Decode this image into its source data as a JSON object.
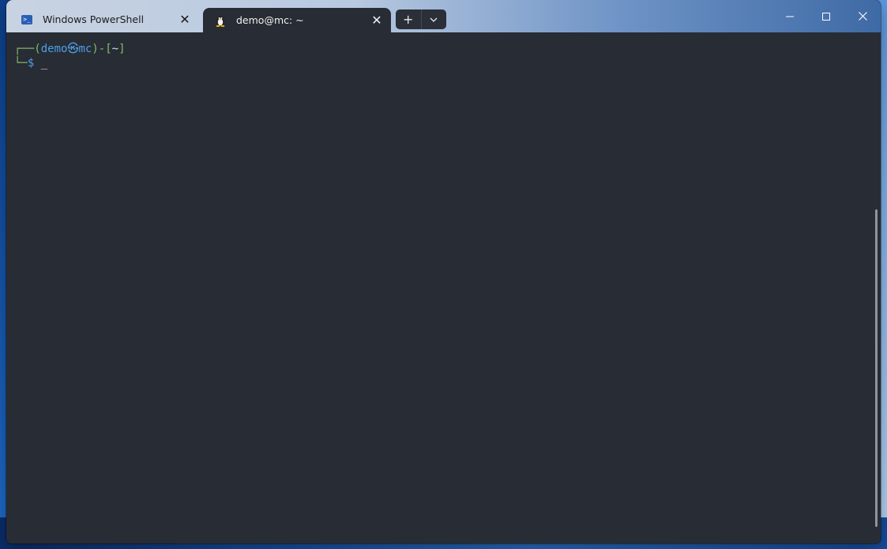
{
  "tabs": [
    {
      "label": "Windows PowerShell",
      "icon": "powershell-icon",
      "active": false
    },
    {
      "label": "demo@mc: ~",
      "icon": "linux-penguin-icon",
      "active": true
    }
  ],
  "newtab": {
    "plus": "+",
    "dropdown": "⌄"
  },
  "window_controls": {
    "minimize": "—",
    "maximize": "☐",
    "close": "✕"
  },
  "terminal": {
    "prompt_corner_top": "┌──",
    "prompt_open": "(",
    "user_host": "demo㉿mc",
    "prompt_close": ")",
    "dash": "-",
    "dir_open": "[",
    "cwd": "~",
    "dir_close": "]",
    "prompt_corner_bottom": "└─",
    "prompt_symbol": "$",
    "cursor": "_"
  },
  "colors": {
    "prompt_green": "#7fbf6a",
    "prompt_blue": "#4d9ee6",
    "terminal_bg": "#282c34"
  }
}
